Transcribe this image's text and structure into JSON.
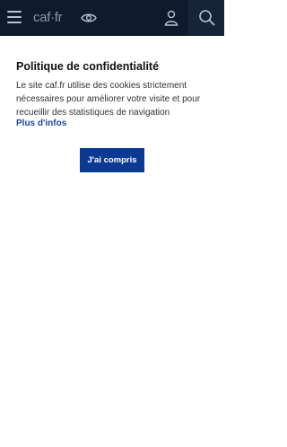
{
  "header": {
    "logo_text": "caf·fr",
    "icons": {
      "menu": "hamburger-menu-icon",
      "accessibility": "eye-icon",
      "account": "user-icon",
      "search": "search-icon"
    },
    "colors": {
      "background": "#0f1b2d",
      "search_background": "#16243a"
    }
  },
  "cookie_banner": {
    "title": "Politique de confidentialité",
    "text": "Le site caf.fr utilise des cookies strictement nécessaires pour améliorer votre visite et pour recueillir des statistiques de navigation",
    "more_link": "Plus d'infos",
    "accept_label": "J'ai compris",
    "colors": {
      "accept_button": "#0b3a93",
      "link": "#1d4a99"
    }
  }
}
